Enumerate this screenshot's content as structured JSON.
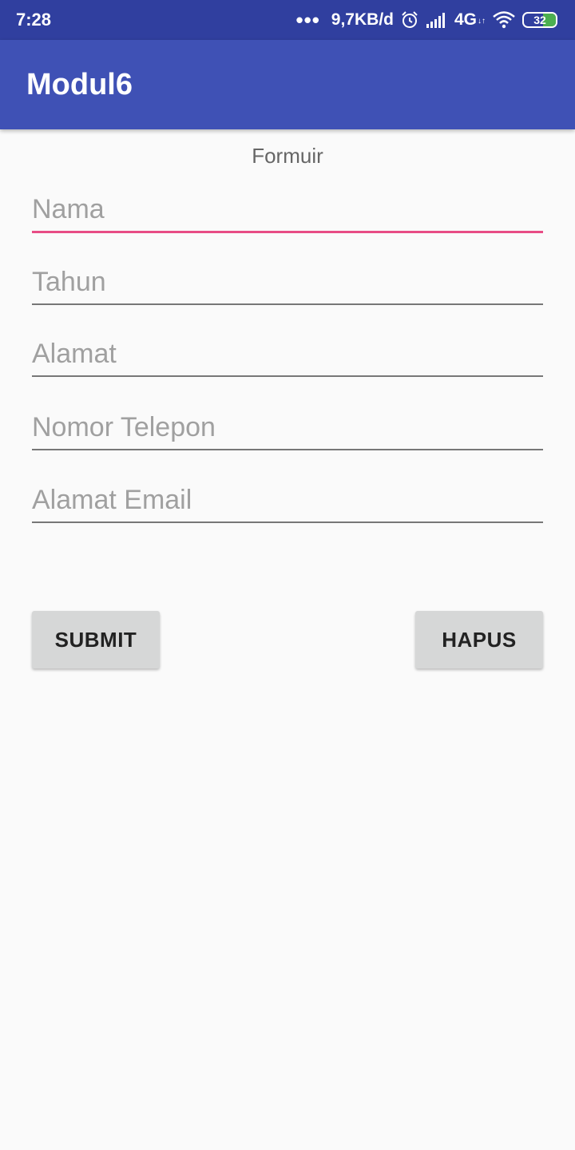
{
  "status_bar": {
    "time": "7:28",
    "more_icon": "dots-icon",
    "net_speed": "9,7KB/d",
    "alarm_icon": "alarm-icon",
    "signal_icon": "signal-icon",
    "network_type": "4G",
    "network_sub": "↓↑",
    "wifi_icon": "wifi-icon",
    "battery_level": "32",
    "battery_color": "#4caf50"
  },
  "app_bar": {
    "title": "Modul6",
    "color": "#3f51b5"
  },
  "form": {
    "title": "Formuir",
    "fields": [
      {
        "placeholder": "Nama",
        "value": "",
        "focused": true
      },
      {
        "placeholder": "Tahun",
        "value": ""
      },
      {
        "placeholder": "Alamat",
        "value": ""
      },
      {
        "placeholder": "Nomor Telepon",
        "value": ""
      },
      {
        "placeholder": "Alamat Email",
        "value": ""
      }
    ],
    "accent_color": "#e84c85"
  },
  "buttons": {
    "submit_label": "SUBMIT",
    "hapus_label": "HAPUS"
  }
}
